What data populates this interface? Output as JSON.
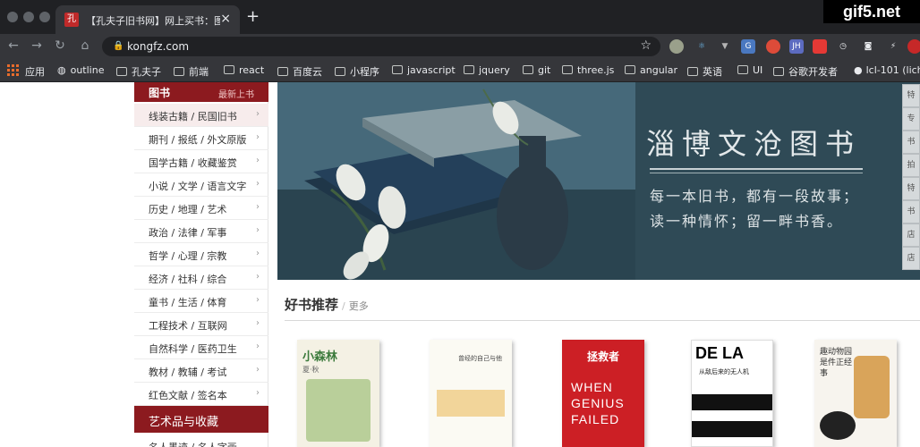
{
  "browser": {
    "tab_title": "【孔夫子旧书网】网上买书：图",
    "tab_favicon": "孔",
    "new_tab": "+",
    "close": "×",
    "url": "kongfz.com",
    "watermark": "gif5.net"
  },
  "bookmarks": [
    {
      "label": "应用",
      "icon": "apps-icon"
    },
    {
      "label": "outline",
      "icon": "globe-icon"
    },
    {
      "label": "孔夫子",
      "icon": "folder-icon"
    },
    {
      "label": "前端",
      "icon": "folder-icon"
    },
    {
      "label": "react",
      "icon": "folder-icon"
    },
    {
      "label": "百度云",
      "icon": "folder-icon"
    },
    {
      "label": "小程序",
      "icon": "folder-icon"
    },
    {
      "label": "javascript",
      "icon": "folder-icon"
    },
    {
      "label": "jquery",
      "icon": "folder-icon"
    },
    {
      "label": "git",
      "icon": "folder-icon"
    },
    {
      "label": "three.js",
      "icon": "folder-icon"
    },
    {
      "label": "angular",
      "icon": "folder-icon"
    },
    {
      "label": "英语",
      "icon": "folder-icon"
    },
    {
      "label": "UI",
      "icon": "folder-icon"
    },
    {
      "label": "谷歌开发者",
      "icon": "folder-icon"
    },
    {
      "label": "lcl-101 (lich",
      "icon": "github-icon"
    }
  ],
  "sidebar": {
    "header_title": "图书",
    "header_link": "最新上书",
    "items": [
      "线装古籍 / 民国旧书",
      "期刊 / 报纸 / 外文原版",
      "国学古籍 / 收藏鉴赏",
      "小说 / 文学 / 语言文字",
      "历史 / 地理 / 艺术",
      "政治 / 法律 / 军事",
      "哲学 / 心理 / 宗教",
      "经济 / 社科 / 综合",
      "童书 / 生活 / 体育",
      "工程技术 / 互联网",
      "自然科学 / 医药卫生",
      "教材 / 教辅 / 考试",
      "红色文献 / 签名本"
    ],
    "arrow": "›",
    "category2": "艺术品与收藏",
    "item_partial": "名人墨迹 / 名人字画"
  },
  "banner": {
    "title": "淄博文沧图书",
    "line1": "每一本旧书，都有一段故事；",
    "line2": "读一种情怀；留一畔书香。",
    "side_tabs": [
      "特",
      "专",
      "书",
      "拍",
      "特",
      "书",
      "店",
      "店"
    ]
  },
  "section": {
    "title": "好书推荐",
    "separator": "/",
    "more": "更多"
  },
  "books": [
    {
      "title": "小森林",
      "subtitle": "夏·秋",
      "bg": "#f4f1e4"
    },
    {
      "title": "曾经的自己与他",
      "subtitle": "",
      "bg": "#fbfaf3"
    },
    {
      "title": "WHEN GENIUS FAILED",
      "subtitle": "拯救者",
      "bg": "#cc1f25"
    },
    {
      "title": "DE LA",
      "subtitle": "从敌后来的无人机",
      "bg": "#ffffff"
    },
    {
      "title": "趣动物园是件正经事",
      "subtitle": "",
      "bg": "#f7f4ee"
    }
  ]
}
